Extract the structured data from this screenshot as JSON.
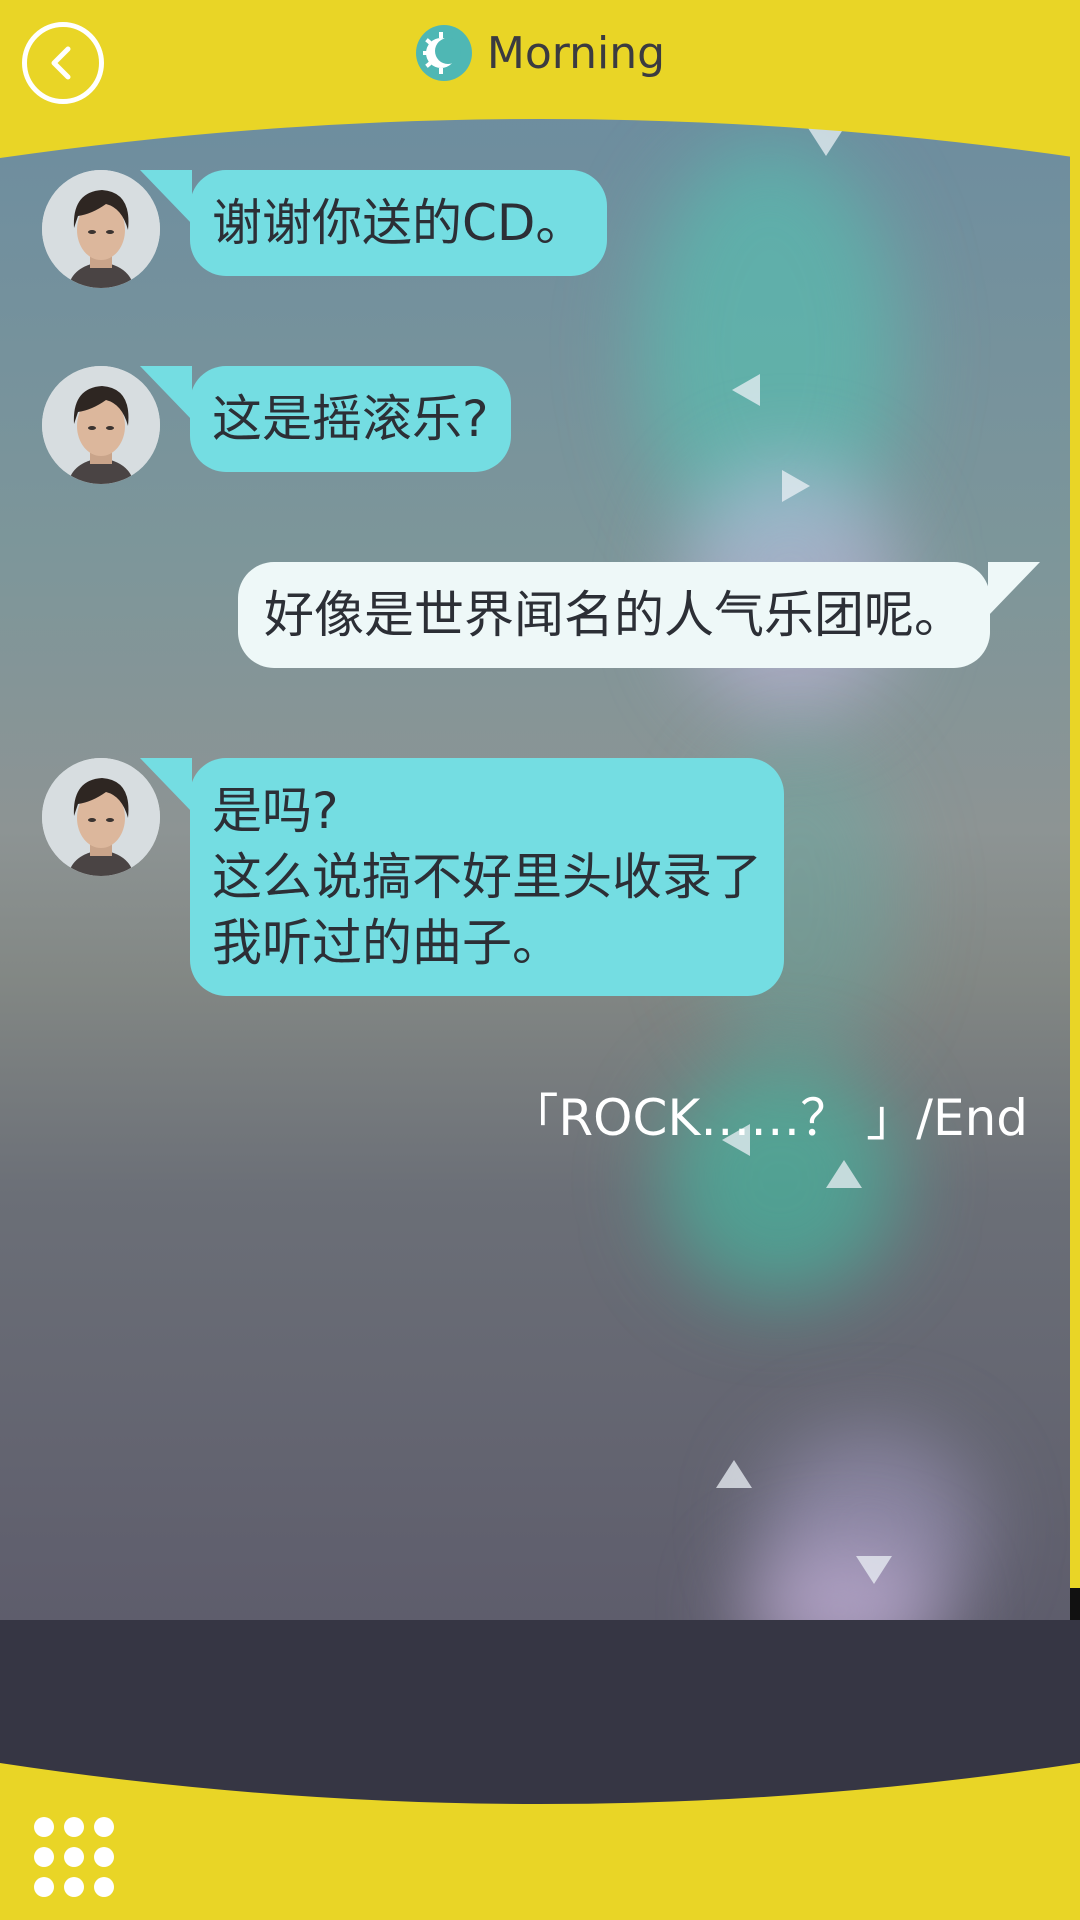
{
  "header": {
    "title": "Morning",
    "back_icon": "chevron-left-icon",
    "time_icon": "moon-sun-icon"
  },
  "messages": [
    {
      "side": "in",
      "text": "谢谢你送的CD。"
    },
    {
      "side": "in",
      "text": "这是摇滚乐?"
    },
    {
      "side": "out",
      "text": "好像是世界闻名的人气乐团呢。"
    },
    {
      "side": "in",
      "text": "是吗?\n这么说搞不好里头收录了\n我听过的曲子。"
    }
  ],
  "end_label": "「ROCK……？ 」/End",
  "footer": {
    "menu_icon": "grid-menu-icon"
  },
  "colors": {
    "header_yellow": "#e9d526",
    "incoming_bubble": "#74dde2",
    "outgoing_bubble": "#eef8f8",
    "footer_dark": "#363644"
  }
}
